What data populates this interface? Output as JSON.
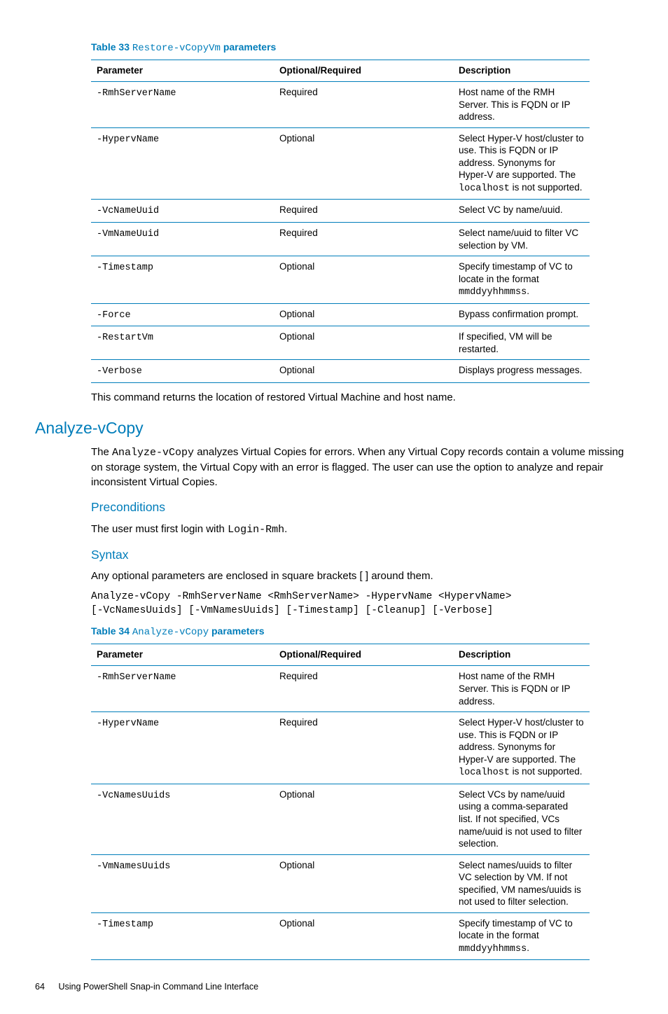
{
  "table33": {
    "caption_num": "Table 33",
    "caption_code": "Restore-vCopyVm",
    "caption_params": "parameters",
    "headers": {
      "param": "Parameter",
      "opt": "Optional/Required",
      "desc": "Description"
    },
    "rows": [
      {
        "param": "-RmhServerName",
        "opt": "Required",
        "desc_pre": "Host name of the RMH Server. This is FQDN or IP address."
      },
      {
        "param": "-HypervName",
        "opt": "Optional",
        "desc_pre": "Select Hyper-V host/cluster to use. This is FQDN or IP address. Synonyms for Hyper-V are supported. The ",
        "code": "localhost",
        "desc_post": " is not supported."
      },
      {
        "param": "-VcNameUuid",
        "opt": "Required",
        "desc_pre": "Select VC by name/uuid."
      },
      {
        "param": "-VmNameUuid",
        "opt": "Required",
        "desc_pre": "Select name/uuid to filter VC selection by VM."
      },
      {
        "param": "-Timestamp",
        "opt": "Optional",
        "desc_pre": "Specify timestamp of VC to locate in the format ",
        "code": "mmddyyhhmmss",
        "desc_post": "."
      },
      {
        "param": "-Force",
        "opt": "Optional",
        "desc_pre": "Bypass confirmation prompt."
      },
      {
        "param": "-RestartVm",
        "opt": "Optional",
        "desc_pre": "If specified, VM will be restarted."
      },
      {
        "param": "-Verbose",
        "opt": "Optional",
        "desc_pre": "Displays progress messages."
      }
    ],
    "note": "This command returns the location of restored Virtual Machine and host name."
  },
  "section": {
    "title": "Analyze-vCopy",
    "intro_pre": "The ",
    "intro_code": "Analyze-vCopy",
    "intro_post": " analyzes Virtual Copies for errors. When any Virtual Copy records contain a volume missing on storage system, the Virtual Copy with an error is flagged. The user can use the option to analyze and repair inconsistent Virtual Copies.",
    "precond_title": "Preconditions",
    "precond_pre": "The user must first login with ",
    "precond_code": "Login-Rmh",
    "precond_post": ".",
    "syntax_title": "Syntax",
    "syntax_note": "Any optional parameters are enclosed in square brackets [ ] around them.",
    "syntax_code": "Analyze-vCopy -RmhServerName <RmhServerName> -HypervName <HypervName>\n[-VcNamesUuids] [-VmNamesUuids] [-Timestamp] [-Cleanup] [-Verbose]"
  },
  "table34": {
    "caption_num": "Table 34",
    "caption_code": "Analyze-vCopy",
    "caption_params": "parameters",
    "headers": {
      "param": "Parameter",
      "opt": "Optional/Required",
      "desc": "Description"
    },
    "rows": [
      {
        "param": "-RmhServerName",
        "opt": "Required",
        "desc_pre": "Host name of the RMH Server. This is FQDN or IP address."
      },
      {
        "param": "-HypervName",
        "opt": "Required",
        "desc_pre": "Select Hyper-V host/cluster to use. This is FQDN or IP address. Synonyms for Hyper-V are supported. The ",
        "code": "localhost",
        "desc_post": " is not supported."
      },
      {
        "param": "-VcNamesUuids",
        "opt": "Optional",
        "desc_pre": "Select VCs by name/uuid using a comma-separated list. If not specified, VCs name/uuid is not used to filter selection."
      },
      {
        "param": "-VmNamesUuids",
        "opt": "Optional",
        "desc_pre": "Select names/uuids to filter VC selection by VM. If not specified, VM names/uuids is not used to filter selection."
      },
      {
        "param": "-Timestamp",
        "opt": "Optional",
        "desc_pre": "Specify timestamp of VC to locate in the format ",
        "code": "mmddyyhhmmss",
        "desc_post": "."
      }
    ]
  },
  "footer": {
    "page": "64",
    "text": "Using PowerShell Snap-in Command Line Interface"
  }
}
